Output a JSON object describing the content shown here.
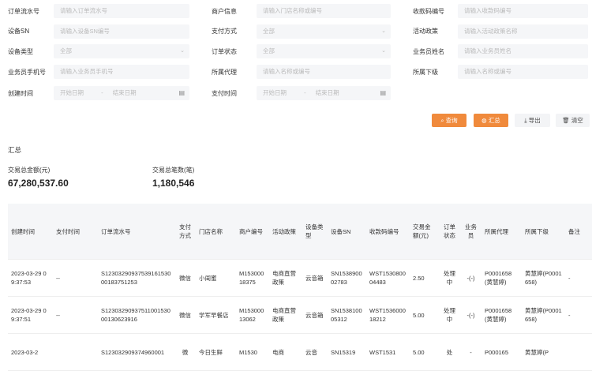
{
  "filters": {
    "order_no": {
      "label": "订单流水号",
      "placeholder": "请输入订单流水号"
    },
    "merchant": {
      "label": "商户信息",
      "placeholder": "请输入门店名称或编号"
    },
    "qrcode_no": {
      "label": "收款码编号",
      "placeholder": "请输入收款码编号"
    },
    "device_sn": {
      "label": "设备SN",
      "placeholder": "请输入设备SN编号"
    },
    "pay_method": {
      "label": "支付方式",
      "value": "全部"
    },
    "activity": {
      "label": "活动政策",
      "placeholder": "请输入活动政策名称"
    },
    "device_type": {
      "label": "设备类型",
      "value": "全部"
    },
    "order_status": {
      "label": "订单状态",
      "value": "全部"
    },
    "salesman_name": {
      "label": "业务员姓名",
      "placeholder": "请输入业务员姓名"
    },
    "salesman_phone": {
      "label": "业务员手机号",
      "placeholder": "请输入业务员手机号"
    },
    "agent": {
      "label": "所属代理",
      "placeholder": "请输入名称或编号"
    },
    "subordinate": {
      "label": "所属下级",
      "placeholder": "请输入名称或编号"
    },
    "create_time": {
      "label": "创建时间",
      "start": "开始日期",
      "sep": "-",
      "end": "结束日期"
    },
    "pay_time": {
      "label": "支付时间",
      "start": "开始日期",
      "sep": "-",
      "end": "结束日期"
    }
  },
  "buttons": {
    "query": "查询",
    "summary": "汇总",
    "export": "导出",
    "clear": "清空"
  },
  "summary": {
    "title": "汇总",
    "total_amount_label": "交易总金额(元)",
    "total_amount": "67,280,537.60",
    "total_count_label": "交易总笔数(笔)",
    "total_count": "1,180,546"
  },
  "table": {
    "headers": [
      "创建时间",
      "支付时间",
      "订单流水号",
      "支付方式",
      "门店名称",
      "商户编号",
      "活动政策",
      "设备类型",
      "设备SN",
      "收款码编号",
      "交易金额(元)",
      "订单状态",
      "业务员",
      "所属代理",
      "所属下级",
      "备注"
    ],
    "rows": [
      [
        "2023-03-29 09:37:53",
        "--",
        "S1230329093753916153000183751253",
        "微信",
        "小闺蜜",
        "M15300018375",
        "电商直营政策",
        "云音箱",
        "SN153890002783",
        "WST153080004483",
        "2.50",
        "处理中",
        "-(-)",
        "P0001658(黄慧婷)",
        "黄慧婷(P0001658)",
        "-"
      ],
      [
        "2023-03-29 09:37:51",
        "--",
        "S1230329093751100153000130623916",
        "微信",
        "学军早餐店",
        "M15300013062",
        "电商直营政策",
        "云音箱",
        "SN153810005312",
        "WST153600018212",
        "5.00",
        "处理中",
        "-(-)",
        "P0001658(黄慧婷)",
        "黄慧婷(P0001658)",
        "-"
      ],
      [
        "2023-03-2",
        "",
        "S123032909374960001",
        "微",
        "今日生鲜",
        "M1530",
        "电商",
        "云音",
        "SN15319",
        "WST1531",
        "5.00",
        "处",
        "-",
        "P000165",
        "黄慧婷(P",
        ""
      ]
    ]
  }
}
